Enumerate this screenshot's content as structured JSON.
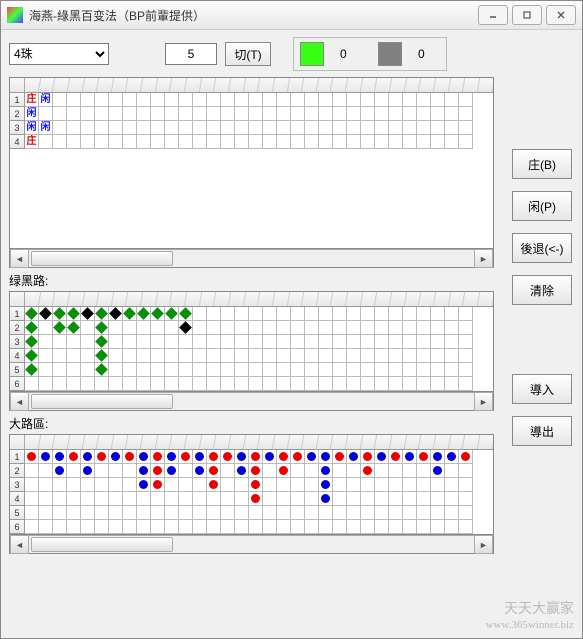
{
  "window": {
    "title": "海燕-綠黑百变法（BP前輩提供）"
  },
  "toolbar": {
    "dropdown_value": "4珠",
    "num_value": "5",
    "cut_label": "切(T)",
    "green_count": "0",
    "gray_count": "0"
  },
  "rbuttons": {
    "banker": "庄(B)",
    "player": "闲(P)",
    "undo": "後退(<-)",
    "clear": "清除",
    "import": "導入",
    "export": "導出"
  },
  "sections": {
    "greenblack_label": "绿黑路:",
    "bigroad_label": "大路區:"
  },
  "grid1": {
    "rows": 4,
    "cols": 32,
    "cells": [
      {
        "r": 0,
        "c": 0,
        "t": "txt",
        "v": "庄",
        "cls": "zh-red"
      },
      {
        "r": 0,
        "c": 1,
        "t": "txt",
        "v": "闲",
        "cls": "zh-blue"
      },
      {
        "r": 1,
        "c": 0,
        "t": "txt",
        "v": "闲",
        "cls": "zh-blue"
      },
      {
        "r": 2,
        "c": 0,
        "t": "txt",
        "v": "闲",
        "cls": "zh-blue"
      },
      {
        "r": 2,
        "c": 1,
        "t": "txt",
        "v": "闲",
        "cls": "zh-blue"
      },
      {
        "r": 3,
        "c": 0,
        "t": "txt",
        "v": "庄",
        "cls": "zh-red"
      }
    ]
  },
  "grid2": {
    "rows": 6,
    "cols": 32,
    "cells": [
      {
        "r": 0,
        "c": 0,
        "t": "d",
        "cls": "d-green"
      },
      {
        "r": 0,
        "c": 1,
        "t": "d",
        "cls": "d-black"
      },
      {
        "r": 0,
        "c": 2,
        "t": "d",
        "cls": "d-green"
      },
      {
        "r": 0,
        "c": 3,
        "t": "d",
        "cls": "d-green"
      },
      {
        "r": 0,
        "c": 4,
        "t": "d",
        "cls": "d-black"
      },
      {
        "r": 0,
        "c": 5,
        "t": "d",
        "cls": "d-green"
      },
      {
        "r": 0,
        "c": 6,
        "t": "d",
        "cls": "d-black"
      },
      {
        "r": 0,
        "c": 7,
        "t": "d",
        "cls": "d-green"
      },
      {
        "r": 0,
        "c": 8,
        "t": "d",
        "cls": "d-green"
      },
      {
        "r": 0,
        "c": 9,
        "t": "d",
        "cls": "d-green"
      },
      {
        "r": 0,
        "c": 10,
        "t": "d",
        "cls": "d-green"
      },
      {
        "r": 0,
        "c": 11,
        "t": "d",
        "cls": "d-green"
      },
      {
        "r": 1,
        "c": 0,
        "t": "d",
        "cls": "d-green"
      },
      {
        "r": 1,
        "c": 2,
        "t": "d",
        "cls": "d-green"
      },
      {
        "r": 1,
        "c": 3,
        "t": "d",
        "cls": "d-green"
      },
      {
        "r": 1,
        "c": 5,
        "t": "d",
        "cls": "d-green"
      },
      {
        "r": 1,
        "c": 11,
        "t": "d",
        "cls": "d-black"
      },
      {
        "r": 2,
        "c": 0,
        "t": "d",
        "cls": "d-green"
      },
      {
        "r": 2,
        "c": 5,
        "t": "d",
        "cls": "d-green"
      },
      {
        "r": 3,
        "c": 0,
        "t": "d",
        "cls": "d-green"
      },
      {
        "r": 3,
        "c": 5,
        "t": "d",
        "cls": "d-green"
      },
      {
        "r": 4,
        "c": 0,
        "t": "d",
        "cls": "d-green"
      },
      {
        "r": 4,
        "c": 5,
        "t": "d",
        "cls": "d-green"
      }
    ]
  },
  "grid3": {
    "rows": 6,
    "cols": 32,
    "cells": [
      {
        "r": 0,
        "c": 0,
        "t": "c",
        "cls": "c-red"
      },
      {
        "r": 0,
        "c": 1,
        "t": "c",
        "cls": "c-blue"
      },
      {
        "r": 0,
        "c": 2,
        "t": "c",
        "cls": "c-blue"
      },
      {
        "r": 0,
        "c": 3,
        "t": "c",
        "cls": "c-red"
      },
      {
        "r": 0,
        "c": 4,
        "t": "c",
        "cls": "c-blue"
      },
      {
        "r": 0,
        "c": 5,
        "t": "c",
        "cls": "c-red"
      },
      {
        "r": 0,
        "c": 6,
        "t": "c",
        "cls": "c-blue"
      },
      {
        "r": 0,
        "c": 7,
        "t": "c",
        "cls": "c-red"
      },
      {
        "r": 0,
        "c": 8,
        "t": "c",
        "cls": "c-blue"
      },
      {
        "r": 0,
        "c": 9,
        "t": "c",
        "cls": "c-red"
      },
      {
        "r": 0,
        "c": 10,
        "t": "c",
        "cls": "c-blue"
      },
      {
        "r": 0,
        "c": 11,
        "t": "c",
        "cls": "c-red"
      },
      {
        "r": 0,
        "c": 12,
        "t": "c",
        "cls": "c-blue"
      },
      {
        "r": 0,
        "c": 13,
        "t": "c",
        "cls": "c-red"
      },
      {
        "r": 0,
        "c": 14,
        "t": "c",
        "cls": "c-red"
      },
      {
        "r": 0,
        "c": 15,
        "t": "c",
        "cls": "c-blue"
      },
      {
        "r": 0,
        "c": 16,
        "t": "c",
        "cls": "c-red"
      },
      {
        "r": 0,
        "c": 17,
        "t": "c",
        "cls": "c-blue"
      },
      {
        "r": 0,
        "c": 18,
        "t": "c",
        "cls": "c-red"
      },
      {
        "r": 0,
        "c": 19,
        "t": "c",
        "cls": "c-red"
      },
      {
        "r": 0,
        "c": 20,
        "t": "c",
        "cls": "c-blue"
      },
      {
        "r": 0,
        "c": 21,
        "t": "c",
        "cls": "c-blue"
      },
      {
        "r": 0,
        "c": 22,
        "t": "c",
        "cls": "c-red"
      },
      {
        "r": 0,
        "c": 23,
        "t": "c",
        "cls": "c-blue"
      },
      {
        "r": 0,
        "c": 24,
        "t": "c",
        "cls": "c-red"
      },
      {
        "r": 0,
        "c": 25,
        "t": "c",
        "cls": "c-blue"
      },
      {
        "r": 0,
        "c": 26,
        "t": "c",
        "cls": "c-red"
      },
      {
        "r": 0,
        "c": 27,
        "t": "c",
        "cls": "c-blue"
      },
      {
        "r": 0,
        "c": 28,
        "t": "c",
        "cls": "c-red"
      },
      {
        "r": 0,
        "c": 29,
        "t": "c",
        "cls": "c-blue"
      },
      {
        "r": 0,
        "c": 30,
        "t": "c",
        "cls": "c-blue"
      },
      {
        "r": 0,
        "c": 31,
        "t": "c",
        "cls": "c-red"
      },
      {
        "r": 1,
        "c": 2,
        "t": "c",
        "cls": "c-blue"
      },
      {
        "r": 1,
        "c": 4,
        "t": "c",
        "cls": "c-blue"
      },
      {
        "r": 1,
        "c": 8,
        "t": "c",
        "cls": "c-blue"
      },
      {
        "r": 1,
        "c": 9,
        "t": "c",
        "cls": "c-red"
      },
      {
        "r": 1,
        "c": 10,
        "t": "c",
        "cls": "c-blue"
      },
      {
        "r": 1,
        "c": 12,
        "t": "c",
        "cls": "c-blue"
      },
      {
        "r": 1,
        "c": 13,
        "t": "c",
        "cls": "c-red"
      },
      {
        "r": 1,
        "c": 15,
        "t": "c",
        "cls": "c-blue"
      },
      {
        "r": 1,
        "c": 16,
        "t": "c",
        "cls": "c-red"
      },
      {
        "r": 1,
        "c": 18,
        "t": "c",
        "cls": "c-red"
      },
      {
        "r": 1,
        "c": 21,
        "t": "c",
        "cls": "c-blue"
      },
      {
        "r": 1,
        "c": 24,
        "t": "c",
        "cls": "c-red"
      },
      {
        "r": 1,
        "c": 29,
        "t": "c",
        "cls": "c-blue"
      },
      {
        "r": 2,
        "c": 8,
        "t": "c",
        "cls": "c-blue"
      },
      {
        "r": 2,
        "c": 9,
        "t": "c",
        "cls": "c-red"
      },
      {
        "r": 2,
        "c": 13,
        "t": "c",
        "cls": "c-red"
      },
      {
        "r": 2,
        "c": 16,
        "t": "c",
        "cls": "c-red"
      },
      {
        "r": 2,
        "c": 21,
        "t": "c",
        "cls": "c-blue"
      },
      {
        "r": 3,
        "c": 16,
        "t": "c",
        "cls": "c-red"
      },
      {
        "r": 3,
        "c": 21,
        "t": "c",
        "cls": "c-blue"
      }
    ]
  },
  "watermark": {
    "line1": "天天大赢家",
    "line2": "www.365winner.biz"
  }
}
